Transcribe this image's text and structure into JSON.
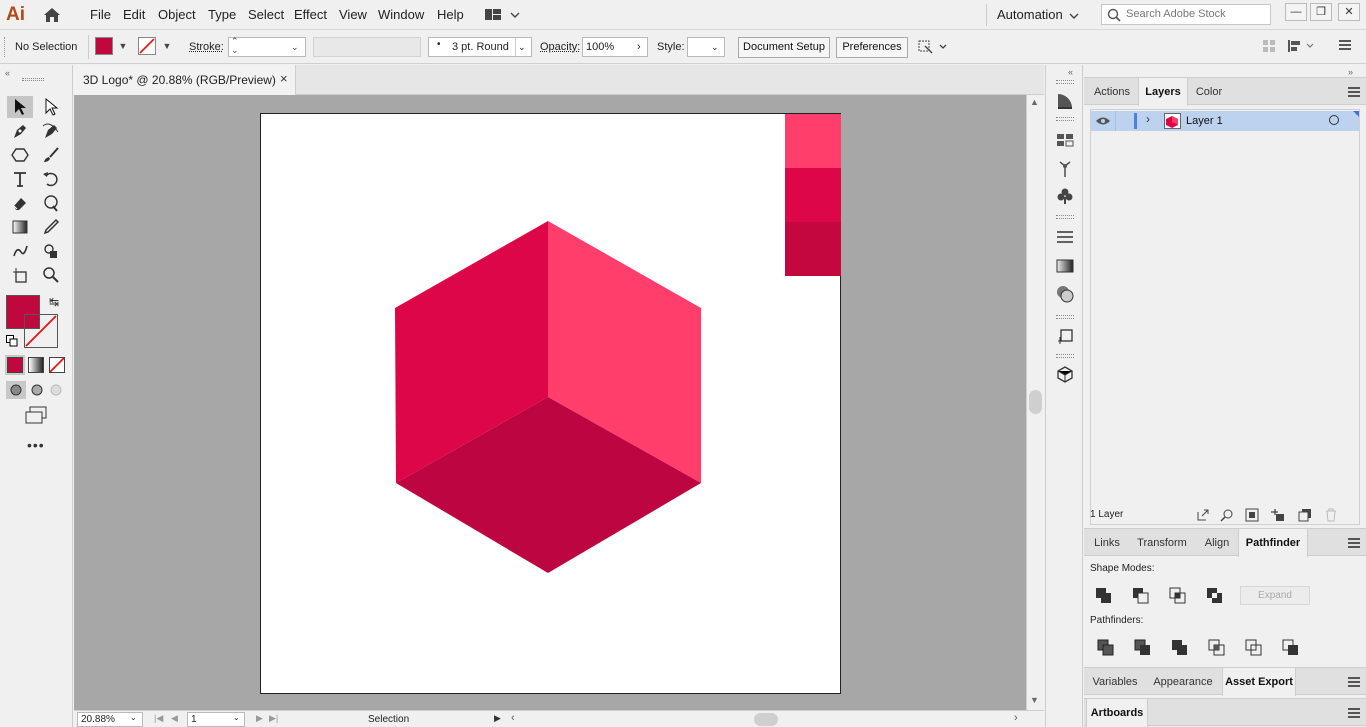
{
  "app": {
    "logo": "Ai"
  },
  "menu": [
    "File",
    "Edit",
    "Object",
    "Type",
    "Select",
    "Effect",
    "View",
    "Window",
    "Help"
  ],
  "workspace": {
    "label": "Automation"
  },
  "search": {
    "placeholder": "Search Adobe Stock"
  },
  "control": {
    "selection": "No Selection",
    "stroke_label": "Stroke:",
    "brush": "3 pt. Round",
    "opacity_label": "Opacity:",
    "opacity_value": "100%",
    "style_label": "Style:",
    "doc_setup": "Document Setup",
    "preferences": "Preferences"
  },
  "document": {
    "tab_title": "3D Logo* @ 20.88% (RGB/Preview)",
    "close": "×"
  },
  "status": {
    "zoom": "20.88%",
    "artboard": "1",
    "tool": "Selection"
  },
  "colors": {
    "fill": "#c0083f",
    "face_left": "#dc0648",
    "face_right": "#ff3e6c",
    "face_bottom": "#bd0541",
    "swatch_top": "#ff3e6c",
    "swatch_mid": "#dc0648",
    "swatch_bottom": "#c4083f"
  },
  "panel_top": {
    "tabs": [
      "Actions",
      "Layers",
      "Color"
    ],
    "active": "Layers",
    "layer_name": "Layer 1",
    "layer_count": "1 Layer"
  },
  "panel_mid": {
    "tabs": [
      "Links",
      "Transform",
      "Align",
      "Pathfinder"
    ],
    "active": "Pathfinder",
    "shape_modes": "Shape Modes:",
    "expand": "Expand",
    "pathfinders": "Pathfinders:"
  },
  "panel_bottom": {
    "tabs": [
      "Variables",
      "Appearance",
      "Asset Export"
    ],
    "active": "Asset Export",
    "next_tab": "Artboards"
  }
}
